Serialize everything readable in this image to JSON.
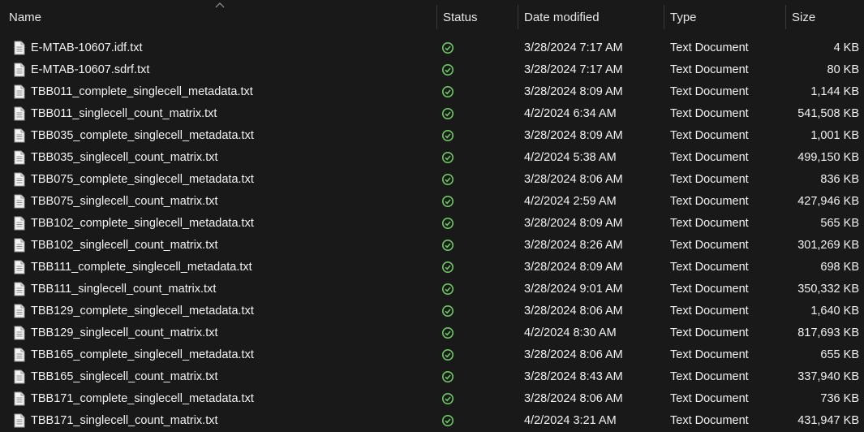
{
  "columns": {
    "name": "Name",
    "status": "Status",
    "date": "Date modified",
    "type": "Type",
    "size": "Size"
  },
  "colors": {
    "background": "#191919",
    "status_ok": "#6ccb5f"
  },
  "icons": {
    "file": "text-document-icon",
    "status": "available-check-icon",
    "sort": "sort-ascending-icon"
  },
  "files": [
    {
      "name": "E-MTAB-10607.idf.txt",
      "date": "3/28/2024 7:17 AM",
      "type": "Text Document",
      "size": "4 KB"
    },
    {
      "name": "E-MTAB-10607.sdrf.txt",
      "date": "3/28/2024 7:17 AM",
      "type": "Text Document",
      "size": "80 KB"
    },
    {
      "name": "TBB011_complete_singlecell_metadata.txt",
      "date": "3/28/2024 8:09 AM",
      "type": "Text Document",
      "size": "1,144 KB"
    },
    {
      "name": "TBB011_singlecell_count_matrix.txt",
      "date": "4/2/2024 6:34 AM",
      "type": "Text Document",
      "size": "541,508 KB"
    },
    {
      "name": "TBB035_complete_singlecell_metadata.txt",
      "date": "3/28/2024 8:09 AM",
      "type": "Text Document",
      "size": "1,001 KB"
    },
    {
      "name": "TBB035_singlecell_count_matrix.txt",
      "date": "4/2/2024 5:38 AM",
      "type": "Text Document",
      "size": "499,150 KB"
    },
    {
      "name": "TBB075_complete_singlecell_metadata.txt",
      "date": "3/28/2024 8:06 AM",
      "type": "Text Document",
      "size": "836 KB"
    },
    {
      "name": "TBB075_singlecell_count_matrix.txt",
      "date": "4/2/2024 2:59 AM",
      "type": "Text Document",
      "size": "427,946 KB"
    },
    {
      "name": "TBB102_complete_singlecell_metadata.txt",
      "date": "3/28/2024 8:09 AM",
      "type": "Text Document",
      "size": "565 KB"
    },
    {
      "name": "TBB102_singlecell_count_matrix.txt",
      "date": "3/28/2024 8:26 AM",
      "type": "Text Document",
      "size": "301,269 KB"
    },
    {
      "name": "TBB111_complete_singlecell_metadata.txt",
      "date": "3/28/2024 8:09 AM",
      "type": "Text Document",
      "size": "698 KB"
    },
    {
      "name": "TBB111_singlecell_count_matrix.txt",
      "date": "3/28/2024 9:01 AM",
      "type": "Text Document",
      "size": "350,332 KB"
    },
    {
      "name": "TBB129_complete_singlecell_metadata.txt",
      "date": "3/28/2024 8:06 AM",
      "type": "Text Document",
      "size": "1,640 KB"
    },
    {
      "name": "TBB129_singlecell_count_matrix.txt",
      "date": "4/2/2024 8:30 AM",
      "type": "Text Document",
      "size": "817,693 KB"
    },
    {
      "name": "TBB165_complete_singlecell_metadata.txt",
      "date": "3/28/2024 8:06 AM",
      "type": "Text Document",
      "size": "655 KB"
    },
    {
      "name": "TBB165_singlecell_count_matrix.txt",
      "date": "3/28/2024 8:43 AM",
      "type": "Text Document",
      "size": "337,940 KB"
    },
    {
      "name": "TBB171_complete_singlecell_metadata.txt",
      "date": "3/28/2024 8:06 AM",
      "type": "Text Document",
      "size": "736 KB"
    },
    {
      "name": "TBB171_singlecell_count_matrix.txt",
      "date": "4/2/2024 3:21 AM",
      "type": "Text Document",
      "size": "431,947 KB"
    }
  ]
}
